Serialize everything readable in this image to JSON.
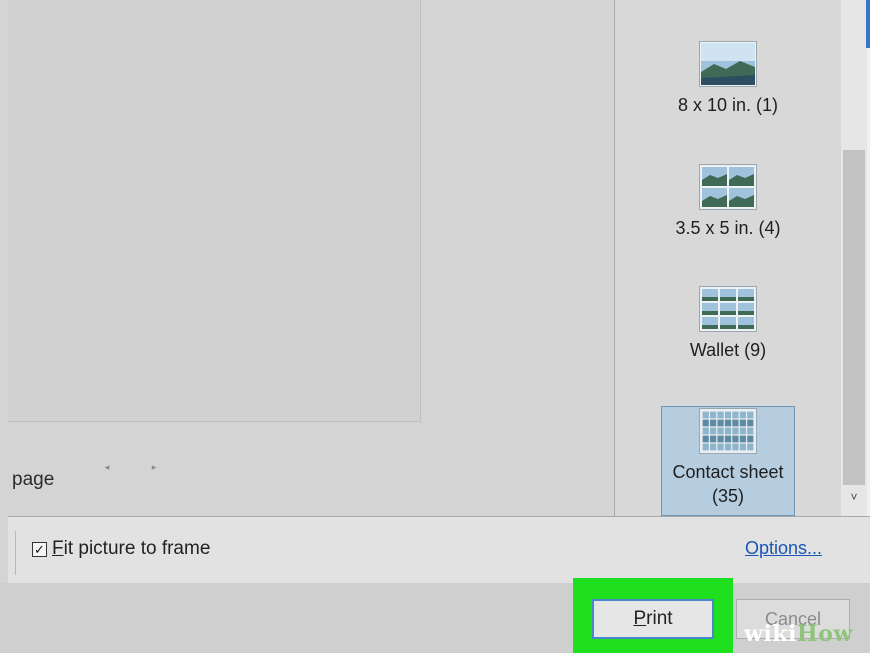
{
  "preview": {
    "page_label": "page",
    "prev_arrow": "◂",
    "next_arrow": "▸"
  },
  "layouts": {
    "items": [
      {
        "label": "8 x 10 in. (1)",
        "grid": 1
      },
      {
        "label": "3.5 x 5 in. (4)",
        "grid": 2
      },
      {
        "label": "Wallet (9)",
        "grid": 3
      },
      {
        "label_line1": "Contact sheet",
        "label_line2": "(35)",
        "grid": 7,
        "selected": true
      }
    ]
  },
  "scrollbar": {
    "down_arrow": "˅"
  },
  "options": {
    "fit_checkbox_mark": "✓",
    "fit_label_underlined": "F",
    "fit_label_rest": "it picture to frame",
    "fit_checked": true,
    "options_link": "Options..."
  },
  "footer": {
    "print_underlined": "P",
    "print_rest": "rint",
    "cancel_label": "Cancel"
  },
  "watermark": {
    "wiki": "wiki",
    "how": "How"
  },
  "colors": {
    "highlight": "#1fe01f",
    "selection": "#b6cde0",
    "link": "#1a56b8"
  }
}
